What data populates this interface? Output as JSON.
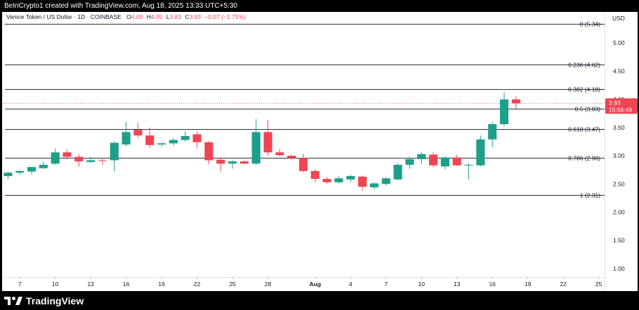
{
  "header": {
    "attribution": "BeInCrypto1 created with TradingView.com, Aug 18, 2025 13:33 UTC+5:30"
  },
  "legend": {
    "symbol": "Venice Token / US Dollar · 1D · COINBASE",
    "o_label": "O",
    "o_value": "4.00",
    "h_label": "H",
    "h_value": "4.05",
    "l_label": "L",
    "l_value": "3.83",
    "c_label": "C",
    "c_value": "3.93",
    "change": "−0.07 (−1.75%)"
  },
  "price_badge": {
    "price": "3.93",
    "countdown": "15:56:49"
  },
  "footer": {
    "logo_text": "TradingView",
    "logo_icon": "tradingview-logo-icon"
  },
  "colors": {
    "up": "#1e9f8a",
    "down": "#ef4453",
    "text_dark": "#131722",
    "grid_line": "#2a2e39",
    "current_price_line": "#ef4453",
    "background": "#ffffff",
    "frame": "#000000"
  },
  "chart_data": {
    "type": "candlestick",
    "currency_label": "USD",
    "y_axis": {
      "ticks": [
        "5.00",
        "4.50",
        "4.00",
        "3.50",
        "3.00",
        "2.50",
        "2.00",
        "1.50",
        "1.00"
      ],
      "range": [
        0.85,
        5.55
      ]
    },
    "x_axis": {
      "tick_labels": [
        "7",
        "10",
        "13",
        "16",
        "19",
        "22",
        "25",
        "28",
        "Aug",
        "4",
        "7",
        "10",
        "13",
        "16",
        "19",
        "22",
        "25"
      ],
      "tick_dates": [
        "2025-07-07",
        "2025-07-10",
        "2025-07-13",
        "2025-07-16",
        "2025-07-19",
        "2025-07-22",
        "2025-07-25",
        "2025-07-28",
        "2025-08-01",
        "2025-08-04",
        "2025-08-07",
        "2025-08-10",
        "2025-08-13",
        "2025-08-16",
        "2025-08-19",
        "2025-08-22",
        "2025-08-25"
      ],
      "range": [
        "2025-07-06",
        "2025-08-26"
      ]
    },
    "fibonacci_levels": [
      {
        "label": "0 (5.34)",
        "value": 5.34
      },
      {
        "label": "0.236 (4.62)",
        "value": 4.62
      },
      {
        "label": "0.382 (4.18)",
        "value": 4.18
      },
      {
        "label": "0.5 (3.83)",
        "value": 3.83
      },
      {
        "label": "0.618 (3.47)",
        "value": 3.47
      },
      {
        "label": "0.786 (2.96)",
        "value": 2.96
      },
      {
        "label": "1 (2.31)",
        "value": 2.31
      }
    ],
    "current_price": 3.93,
    "candles": [
      {
        "date": "2025-07-06",
        "o": 2.64,
        "h": 2.72,
        "l": 2.58,
        "c": 2.7
      },
      {
        "date": "2025-07-07",
        "o": 2.7,
        "h": 2.74,
        "l": 2.66,
        "c": 2.73
      },
      {
        "date": "2025-07-08",
        "o": 2.72,
        "h": 2.8,
        "l": 2.67,
        "c": 2.8
      },
      {
        "date": "2025-07-09",
        "o": 2.78,
        "h": 2.9,
        "l": 2.76,
        "c": 2.84
      },
      {
        "date": "2025-07-10",
        "o": 2.86,
        "h": 3.13,
        "l": 2.84,
        "c": 3.06
      },
      {
        "date": "2025-07-11",
        "o": 3.06,
        "h": 3.12,
        "l": 2.94,
        "c": 2.98
      },
      {
        "date": "2025-07-12",
        "o": 2.98,
        "h": 3.03,
        "l": 2.81,
        "c": 2.9
      },
      {
        "date": "2025-07-13",
        "o": 2.89,
        "h": 2.98,
        "l": 2.87,
        "c": 2.92
      },
      {
        "date": "2025-07-14",
        "o": 2.92,
        "h": 2.96,
        "l": 2.84,
        "c": 2.91
      },
      {
        "date": "2025-07-15",
        "o": 2.92,
        "h": 3.25,
        "l": 2.72,
        "c": 3.23
      },
      {
        "date": "2025-07-16",
        "o": 3.2,
        "h": 3.6,
        "l": 3.17,
        "c": 3.42
      },
      {
        "date": "2025-07-17",
        "o": 3.46,
        "h": 3.58,
        "l": 3.32,
        "c": 3.36
      },
      {
        "date": "2025-07-18",
        "o": 3.36,
        "h": 3.5,
        "l": 3.14,
        "c": 3.19
      },
      {
        "date": "2025-07-19",
        "o": 3.2,
        "h": 3.23,
        "l": 3.16,
        "c": 3.22
      },
      {
        "date": "2025-07-20",
        "o": 3.22,
        "h": 3.32,
        "l": 3.18,
        "c": 3.28
      },
      {
        "date": "2025-07-21",
        "o": 3.28,
        "h": 3.44,
        "l": 3.25,
        "c": 3.35
      },
      {
        "date": "2025-07-22",
        "o": 3.38,
        "h": 3.43,
        "l": 3.14,
        "c": 3.24
      },
      {
        "date": "2025-07-23",
        "o": 3.24,
        "h": 3.26,
        "l": 2.85,
        "c": 2.92
      },
      {
        "date": "2025-07-24",
        "o": 2.93,
        "h": 2.97,
        "l": 2.72,
        "c": 2.86
      },
      {
        "date": "2025-07-25",
        "o": 2.86,
        "h": 2.92,
        "l": 2.77,
        "c": 2.9
      },
      {
        "date": "2025-07-26",
        "o": 2.9,
        "h": 2.92,
        "l": 2.85,
        "c": 2.86
      },
      {
        "date": "2025-07-27",
        "o": 2.86,
        "h": 3.65,
        "l": 2.84,
        "c": 3.42
      },
      {
        "date": "2025-07-28",
        "o": 3.42,
        "h": 3.63,
        "l": 3.0,
        "c": 3.06
      },
      {
        "date": "2025-07-29",
        "o": 3.06,
        "h": 3.12,
        "l": 2.99,
        "c": 3.01
      },
      {
        "date": "2025-07-30",
        "o": 3.0,
        "h": 3.02,
        "l": 2.92,
        "c": 2.96
      },
      {
        "date": "2025-07-31",
        "o": 2.96,
        "h": 3.04,
        "l": 2.71,
        "c": 2.73
      },
      {
        "date": "2025-08-01",
        "o": 2.73,
        "h": 2.76,
        "l": 2.53,
        "c": 2.59
      },
      {
        "date": "2025-08-02",
        "o": 2.59,
        "h": 2.62,
        "l": 2.5,
        "c": 2.53
      },
      {
        "date": "2025-08-03",
        "o": 2.53,
        "h": 2.64,
        "l": 2.51,
        "c": 2.6
      },
      {
        "date": "2025-08-04",
        "o": 2.58,
        "h": 2.66,
        "l": 2.53,
        "c": 2.64
      },
      {
        "date": "2025-08-05",
        "o": 2.63,
        "h": 2.65,
        "l": 2.38,
        "c": 2.45
      },
      {
        "date": "2025-08-06",
        "o": 2.44,
        "h": 2.53,
        "l": 2.41,
        "c": 2.51
      },
      {
        "date": "2025-08-07",
        "o": 2.5,
        "h": 2.62,
        "l": 2.48,
        "c": 2.6
      },
      {
        "date": "2025-08-08",
        "o": 2.58,
        "h": 2.87,
        "l": 2.56,
        "c": 2.84
      },
      {
        "date": "2025-08-09",
        "o": 2.84,
        "h": 2.98,
        "l": 2.77,
        "c": 2.94
      },
      {
        "date": "2025-08-10",
        "o": 2.94,
        "h": 3.06,
        "l": 2.85,
        "c": 3.03
      },
      {
        "date": "2025-08-11",
        "o": 3.02,
        "h": 3.06,
        "l": 2.8,
        "c": 2.83
      },
      {
        "date": "2025-08-12",
        "o": 2.81,
        "h": 2.99,
        "l": 2.76,
        "c": 2.97
      },
      {
        "date": "2025-08-13",
        "o": 2.97,
        "h": 3.02,
        "l": 2.82,
        "c": 2.83
      },
      {
        "date": "2025-08-14",
        "o": 2.83,
        "h": 2.87,
        "l": 2.58,
        "c": 2.84
      },
      {
        "date": "2025-08-15",
        "o": 2.83,
        "h": 3.36,
        "l": 2.81,
        "c": 3.29
      },
      {
        "date": "2025-08-16",
        "o": 3.29,
        "h": 3.6,
        "l": 3.15,
        "c": 3.56
      },
      {
        "date": "2025-08-17",
        "o": 3.56,
        "h": 4.13,
        "l": 3.52,
        "c": 4.0
      },
      {
        "date": "2025-08-18",
        "o": 4.0,
        "h": 4.05,
        "l": 3.83,
        "c": 3.93
      }
    ]
  }
}
